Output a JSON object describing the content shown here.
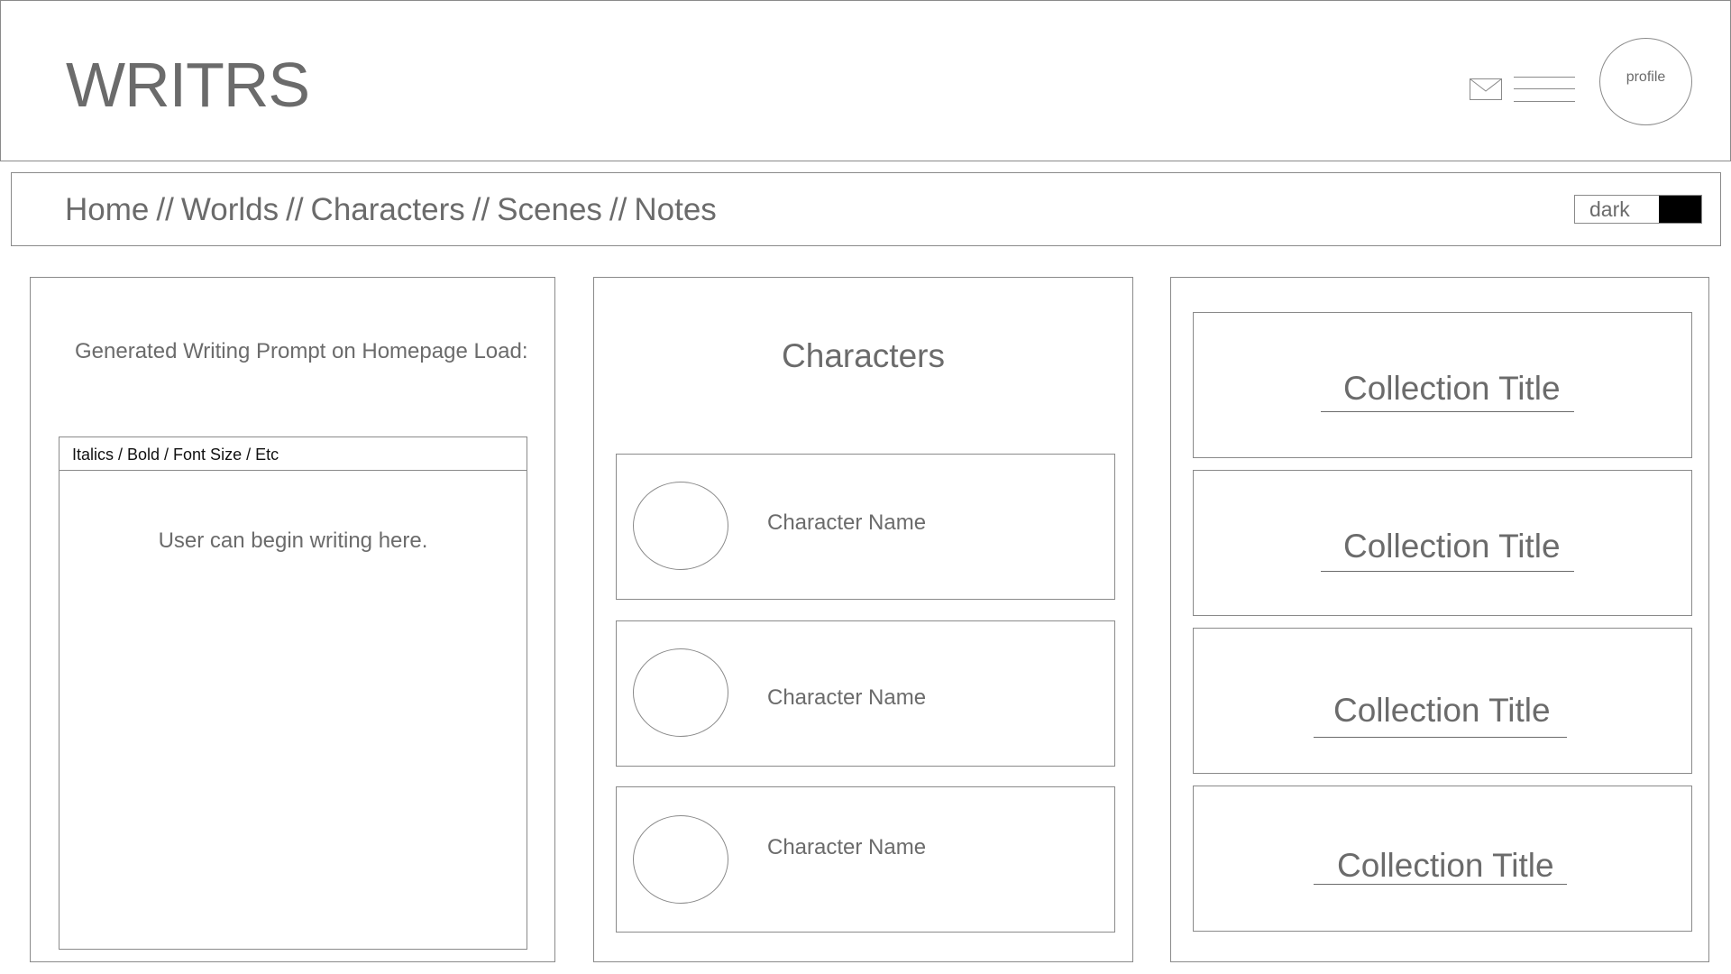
{
  "header": {
    "logo": "WRITRS",
    "profile_label": "profile"
  },
  "nav": {
    "breadcrumb": [
      {
        "label": "Home"
      },
      {
        "label": "Worlds"
      },
      {
        "label": "Characters"
      },
      {
        "label": "Scenes"
      },
      {
        "label": "Notes"
      }
    ],
    "separator": "//",
    "theme_toggle_label": "dark",
    "theme_swatch_color": "#000000"
  },
  "prompt_panel": {
    "label": "Generated Writing Prompt on Homepage Load:",
    "toolbar_label": "Italics / Bold / Font Size / Etc",
    "editor_placeholder": "User can begin writing here."
  },
  "characters_panel": {
    "title": "Characters",
    "items": [
      {
        "name": "Character Name"
      },
      {
        "name": "Character Name"
      },
      {
        "name": "Character Name"
      }
    ]
  },
  "collections_panel": {
    "items": [
      {
        "title": "Collection Title"
      },
      {
        "title": "Collection Title"
      },
      {
        "title": "Collection Title"
      },
      {
        "title": "Collection Title"
      }
    ]
  },
  "colors": {
    "border": "#8a8a8a",
    "text": "#6b6b6b",
    "background": "#ffffff"
  }
}
